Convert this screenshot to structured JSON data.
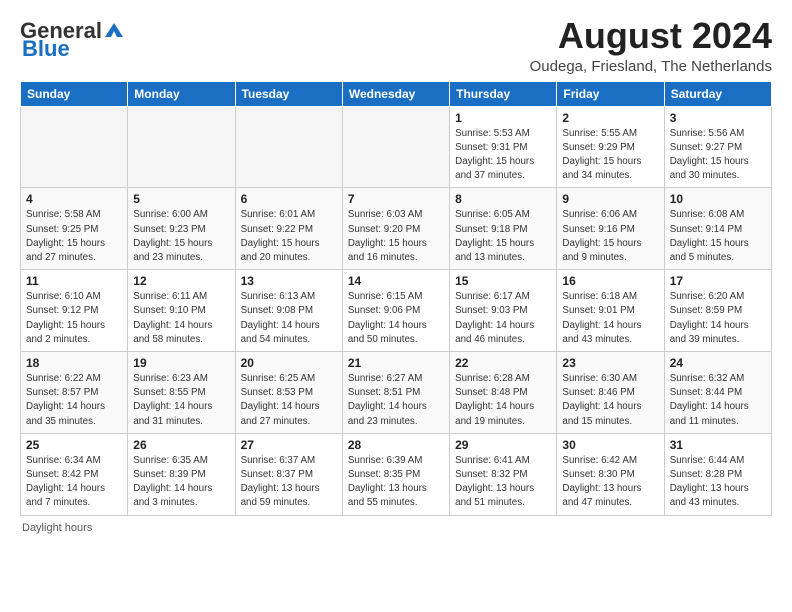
{
  "header": {
    "logo_general": "General",
    "logo_blue": "Blue",
    "title": "August 2024",
    "location": "Oudega, Friesland, The Netherlands"
  },
  "days_of_week": [
    "Sunday",
    "Monday",
    "Tuesday",
    "Wednesday",
    "Thursday",
    "Friday",
    "Saturday"
  ],
  "weeks": [
    [
      {
        "day": "",
        "info": ""
      },
      {
        "day": "",
        "info": ""
      },
      {
        "day": "",
        "info": ""
      },
      {
        "day": "",
        "info": ""
      },
      {
        "day": "1",
        "info": "Sunrise: 5:53 AM\nSunset: 9:31 PM\nDaylight: 15 hours\nand 37 minutes."
      },
      {
        "day": "2",
        "info": "Sunrise: 5:55 AM\nSunset: 9:29 PM\nDaylight: 15 hours\nand 34 minutes."
      },
      {
        "day": "3",
        "info": "Sunrise: 5:56 AM\nSunset: 9:27 PM\nDaylight: 15 hours\nand 30 minutes."
      }
    ],
    [
      {
        "day": "4",
        "info": "Sunrise: 5:58 AM\nSunset: 9:25 PM\nDaylight: 15 hours\nand 27 minutes."
      },
      {
        "day": "5",
        "info": "Sunrise: 6:00 AM\nSunset: 9:23 PM\nDaylight: 15 hours\nand 23 minutes."
      },
      {
        "day": "6",
        "info": "Sunrise: 6:01 AM\nSunset: 9:22 PM\nDaylight: 15 hours\nand 20 minutes."
      },
      {
        "day": "7",
        "info": "Sunrise: 6:03 AM\nSunset: 9:20 PM\nDaylight: 15 hours\nand 16 minutes."
      },
      {
        "day": "8",
        "info": "Sunrise: 6:05 AM\nSunset: 9:18 PM\nDaylight: 15 hours\nand 13 minutes."
      },
      {
        "day": "9",
        "info": "Sunrise: 6:06 AM\nSunset: 9:16 PM\nDaylight: 15 hours\nand 9 minutes."
      },
      {
        "day": "10",
        "info": "Sunrise: 6:08 AM\nSunset: 9:14 PM\nDaylight: 15 hours\nand 5 minutes."
      }
    ],
    [
      {
        "day": "11",
        "info": "Sunrise: 6:10 AM\nSunset: 9:12 PM\nDaylight: 15 hours\nand 2 minutes."
      },
      {
        "day": "12",
        "info": "Sunrise: 6:11 AM\nSunset: 9:10 PM\nDaylight: 14 hours\nand 58 minutes."
      },
      {
        "day": "13",
        "info": "Sunrise: 6:13 AM\nSunset: 9:08 PM\nDaylight: 14 hours\nand 54 minutes."
      },
      {
        "day": "14",
        "info": "Sunrise: 6:15 AM\nSunset: 9:06 PM\nDaylight: 14 hours\nand 50 minutes."
      },
      {
        "day": "15",
        "info": "Sunrise: 6:17 AM\nSunset: 9:03 PM\nDaylight: 14 hours\nand 46 minutes."
      },
      {
        "day": "16",
        "info": "Sunrise: 6:18 AM\nSunset: 9:01 PM\nDaylight: 14 hours\nand 43 minutes."
      },
      {
        "day": "17",
        "info": "Sunrise: 6:20 AM\nSunset: 8:59 PM\nDaylight: 14 hours\nand 39 minutes."
      }
    ],
    [
      {
        "day": "18",
        "info": "Sunrise: 6:22 AM\nSunset: 8:57 PM\nDaylight: 14 hours\nand 35 minutes."
      },
      {
        "day": "19",
        "info": "Sunrise: 6:23 AM\nSunset: 8:55 PM\nDaylight: 14 hours\nand 31 minutes."
      },
      {
        "day": "20",
        "info": "Sunrise: 6:25 AM\nSunset: 8:53 PM\nDaylight: 14 hours\nand 27 minutes."
      },
      {
        "day": "21",
        "info": "Sunrise: 6:27 AM\nSunset: 8:51 PM\nDaylight: 14 hours\nand 23 minutes."
      },
      {
        "day": "22",
        "info": "Sunrise: 6:28 AM\nSunset: 8:48 PM\nDaylight: 14 hours\nand 19 minutes."
      },
      {
        "day": "23",
        "info": "Sunrise: 6:30 AM\nSunset: 8:46 PM\nDaylight: 14 hours\nand 15 minutes."
      },
      {
        "day": "24",
        "info": "Sunrise: 6:32 AM\nSunset: 8:44 PM\nDaylight: 14 hours\nand 11 minutes."
      }
    ],
    [
      {
        "day": "25",
        "info": "Sunrise: 6:34 AM\nSunset: 8:42 PM\nDaylight: 14 hours\nand 7 minutes."
      },
      {
        "day": "26",
        "info": "Sunrise: 6:35 AM\nSunset: 8:39 PM\nDaylight: 14 hours\nand 3 minutes."
      },
      {
        "day": "27",
        "info": "Sunrise: 6:37 AM\nSunset: 8:37 PM\nDaylight: 13 hours\nand 59 minutes."
      },
      {
        "day": "28",
        "info": "Sunrise: 6:39 AM\nSunset: 8:35 PM\nDaylight: 13 hours\nand 55 minutes."
      },
      {
        "day": "29",
        "info": "Sunrise: 6:41 AM\nSunset: 8:32 PM\nDaylight: 13 hours\nand 51 minutes."
      },
      {
        "day": "30",
        "info": "Sunrise: 6:42 AM\nSunset: 8:30 PM\nDaylight: 13 hours\nand 47 minutes."
      },
      {
        "day": "31",
        "info": "Sunrise: 6:44 AM\nSunset: 8:28 PM\nDaylight: 13 hours\nand 43 minutes."
      }
    ]
  ],
  "footer": {
    "note": "Daylight hours"
  }
}
